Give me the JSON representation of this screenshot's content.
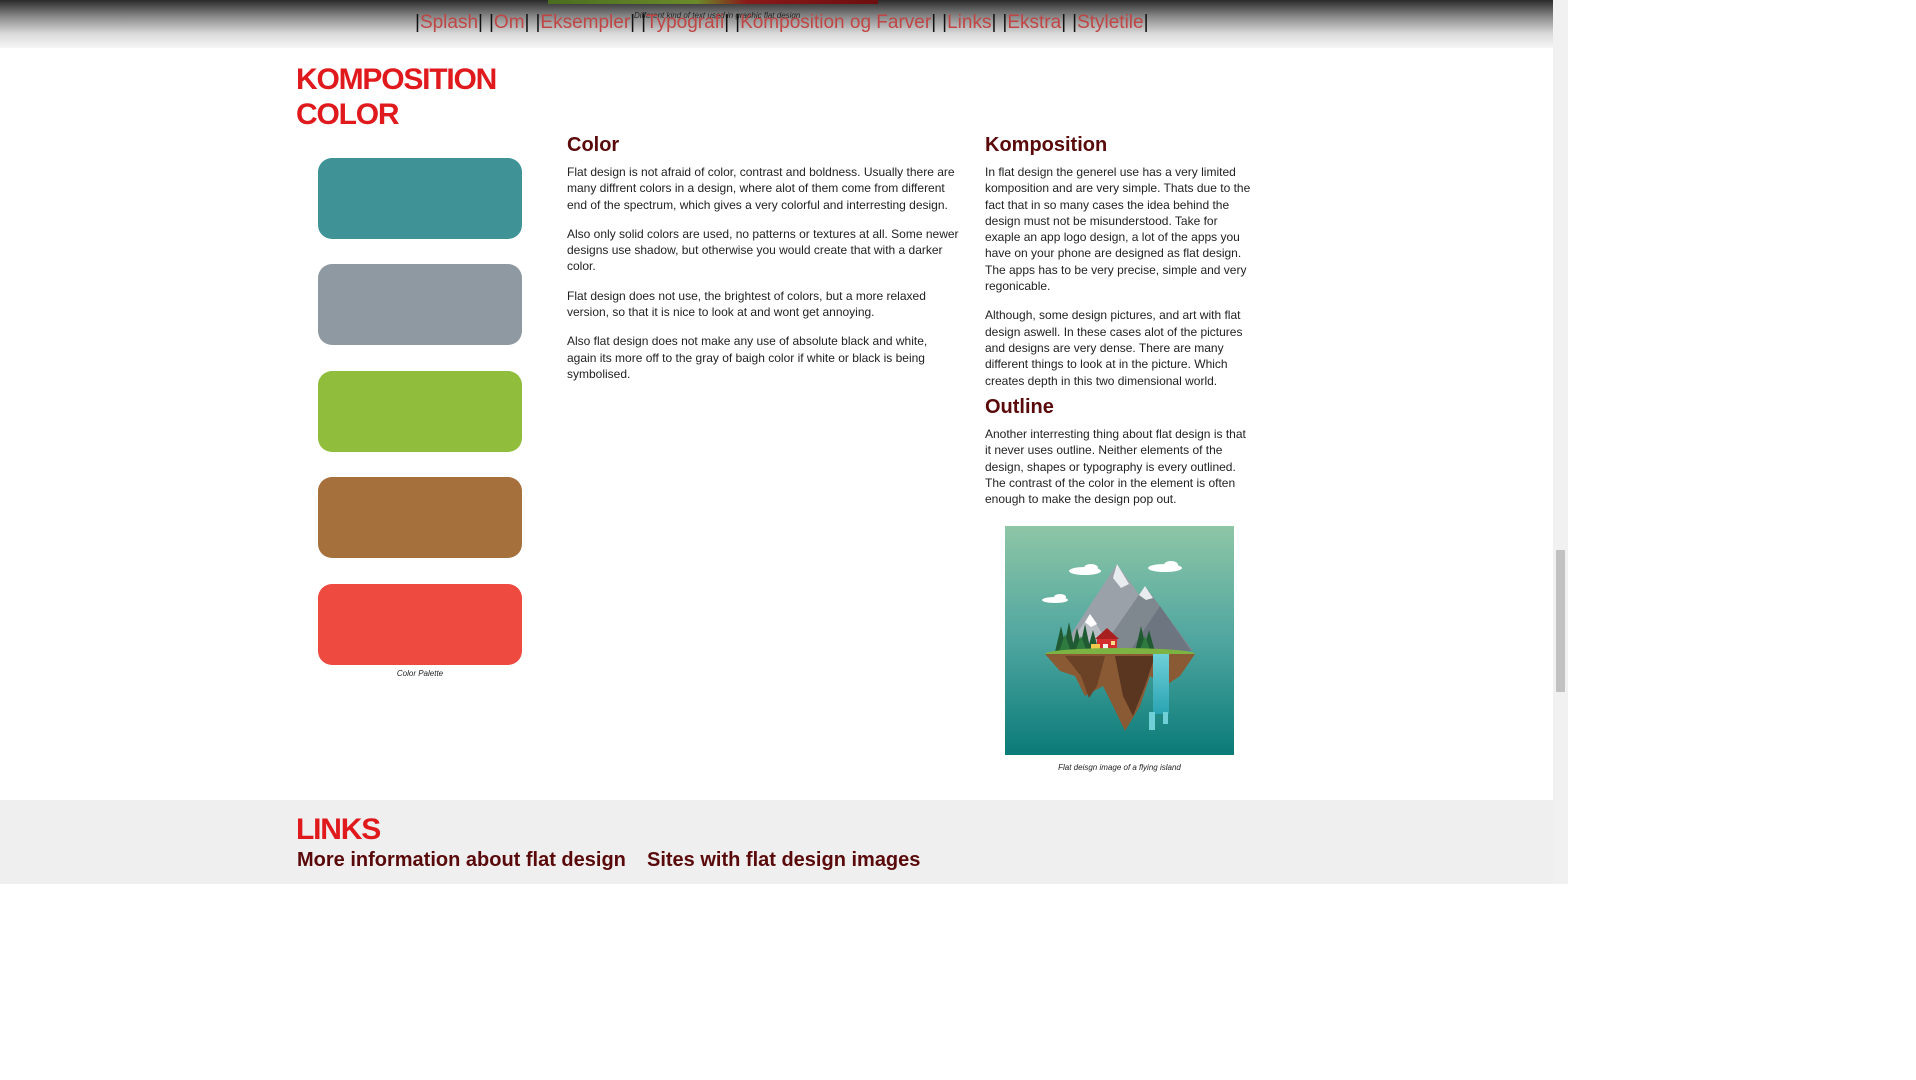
{
  "nav": {
    "peek_caption": "Different kind of text used in graphic flat design",
    "items": [
      {
        "label": "Splash"
      },
      {
        "label": "Om"
      },
      {
        "label": "Eksempler"
      },
      {
        "label": "Typografi"
      },
      {
        "label": "Komposition og Farver"
      },
      {
        "label": "Links"
      },
      {
        "label": "Ekstra"
      },
      {
        "label": "Styletile"
      }
    ],
    "separator": "|"
  },
  "section": {
    "title": "KOMPOSITION COLOR"
  },
  "palette": {
    "swatches": [
      {
        "color": "#3f9396"
      },
      {
        "color": "#8e99a1"
      },
      {
        "color": "#90be3c"
      },
      {
        "color": "#a5703b"
      },
      {
        "color": "#ef4a40"
      }
    ],
    "caption": "Color Palette"
  },
  "color_section": {
    "heading": "Color",
    "paragraphs": [
      "Flat design is not afraid of color, contrast and boldness. Usually there are many diffrent colors in a design, where alot of them come from different end of the spectrum, which gives a very colorful and interresting design.",
      "Also only solid colors are used, no patterns or textures at all. Some newer designs use shadow, but otherwise you would create that with a darker color.",
      "Flat design does not use, the brightest of colors, but a more relaxed version, so that it is nice to look at and wont get annoying.",
      "Also flat design does not make any use of absolute black and white, again its more off to the gray of baigh color if white or black is being symbolised."
    ]
  },
  "komposition_section": {
    "heading": "Komposition",
    "paragraphs": [
      "In flat design the generel use has a very limited komposition and are very simple. Thats due to the fact that in so many cases the idea behind the design must not be misunderstood. Take for exaple an app logo design, a lot of the apps you have on your phone are designed as flat design. The apps has to be very precise, simple and very regonicable.",
      "Although, some design pictures, and art with flat design aswell. In these cases alot of the pictures and designs are very dense. There are many different things to look at in the picture. Which creates depth in this two dimensional world."
    ]
  },
  "outline_section": {
    "heading": "Outline",
    "paragraphs": [
      "Another interresting thing about flat design is that it never uses outline. Neither elements of the design, shapes or typography is every outlined. The contrast of the color in the element is often enough to make the design pop out."
    ]
  },
  "island_image": {
    "caption": "Flat deisgn image of a flying island"
  },
  "links_section": {
    "title": "LINKS",
    "subheadings": [
      "More information about flat design",
      "Sites with flat design images"
    ]
  },
  "colors": {
    "accent_red": "#e0191d",
    "heading_dark_red": "#5a0a0a",
    "nav_link": "#c04545"
  }
}
